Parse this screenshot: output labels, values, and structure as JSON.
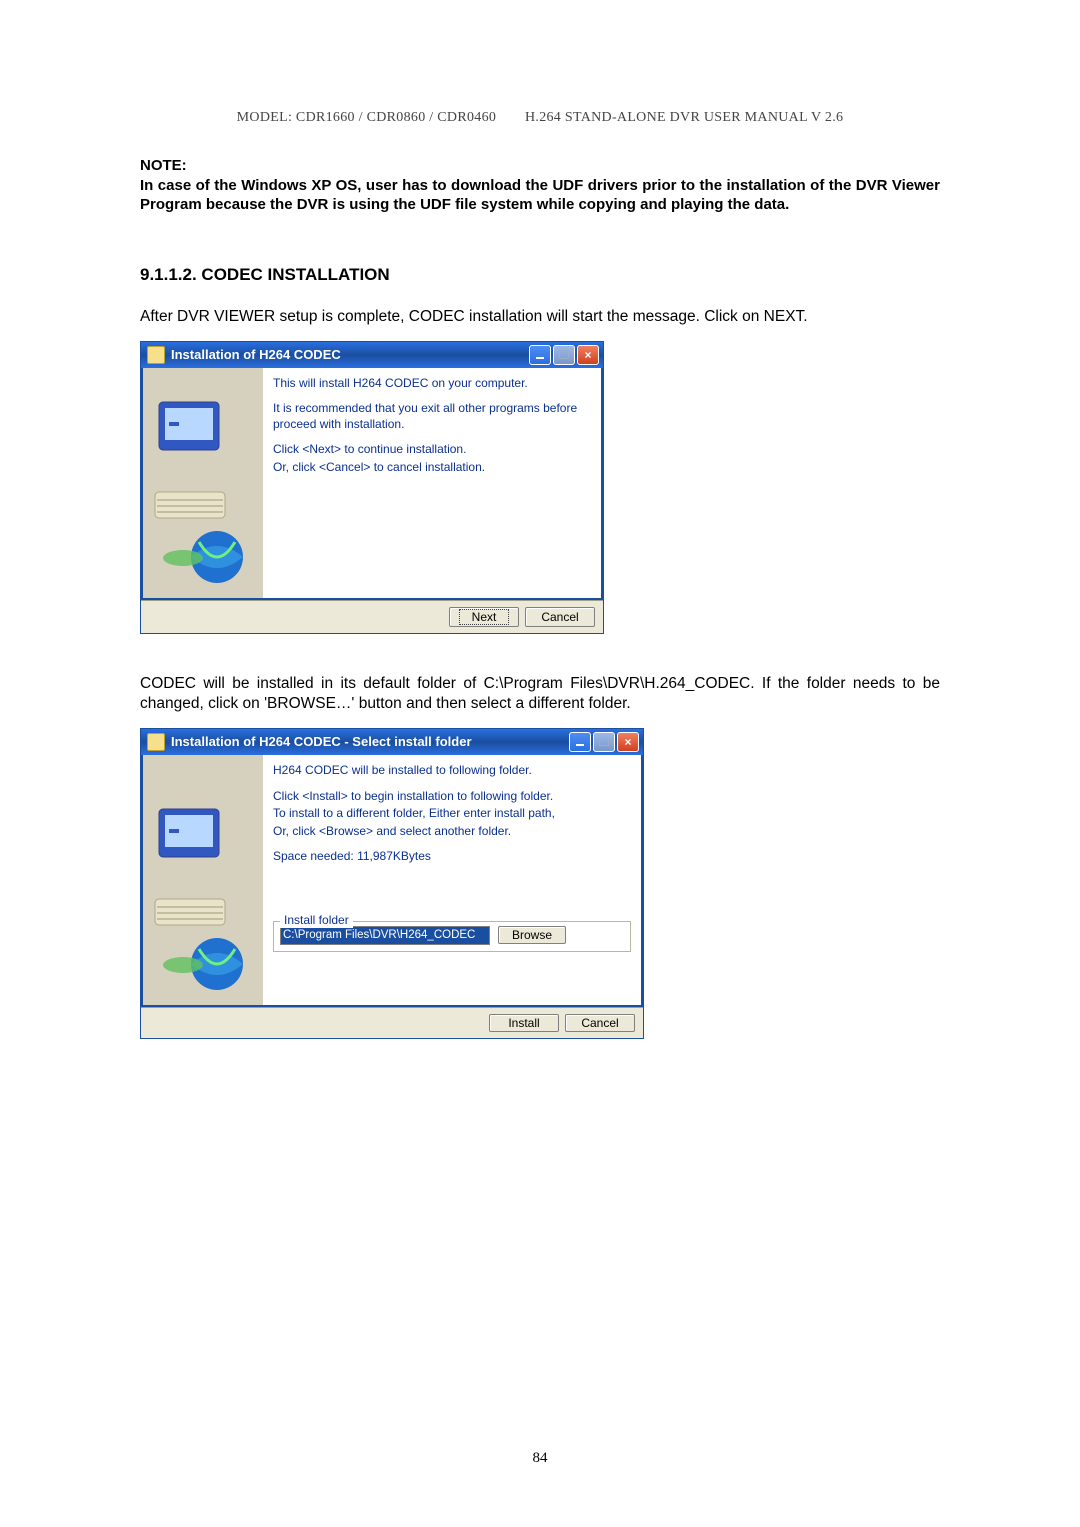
{
  "header": {
    "left": "MODEL: CDR1660 / CDR0860 / CDR0460",
    "right": "H.264 STAND-ALONE DVR USER MANUAL V 2.6"
  },
  "note": {
    "label": "NOTE:",
    "body": "In case of the Windows XP OS, user has to download the UDF drivers prior to the installation of the DVR Viewer Program because the DVR is using the UDF file system while copying and playing the data."
  },
  "section": {
    "number": "9.1.1.2.  CODEC INSTALLATION"
  },
  "para1": "After DVR VIEWER setup is complete, CODEC installation will start the message. Click on NEXT.",
  "dialog1": {
    "title": "Installation of H264 CODEC",
    "line1": "This will install H264 CODEC on your computer.",
    "line2": "It is recommended that you exit all other programs before proceed with installation.",
    "line3": "Click <Next> to continue installation.",
    "line4": "Or, click <Cancel> to cancel installation.",
    "next": "Next",
    "cancel": "Cancel"
  },
  "para2": "CODEC will be installed in its default folder of C:\\Program Files\\DVR\\H.264_CODEC.  If the folder needs to be changed, click on 'BROWSE…' button and then select a different folder.",
  "dialog2": {
    "title": "Installation of H264 CODEC - Select install folder",
    "line1": "H264 CODEC will be installed to following folder.",
    "line2": "Click <Install> to begin installation to following folder.",
    "line3": "To install to a different folder, Either enter install path,",
    "line4": "Or, click <Browse> and select another folder.",
    "space": "Space needed: 11,987KBytes",
    "group_label": "Install folder",
    "path": "C:\\Program Files\\DVR\\H264_CODEC",
    "browse": "Browse",
    "install": "Install",
    "cancel": "Cancel"
  },
  "pagenum": "84"
}
